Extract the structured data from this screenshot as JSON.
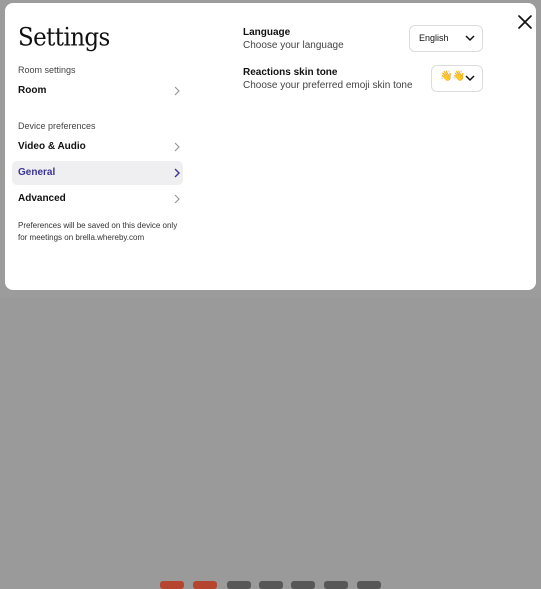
{
  "settings": {
    "title": "Settings",
    "room_section": "Room settings",
    "device_section": "Device preferences",
    "nav": [
      {
        "label": "Room",
        "active": false
      },
      {
        "label": "Video & Audio",
        "active": false
      },
      {
        "label": "General",
        "active": true
      },
      {
        "label": "Advanced",
        "active": false
      }
    ],
    "note": "Preferences will be saved on this device only for meetings on brella.whereby.com"
  },
  "general": {
    "language": {
      "title": "Language",
      "description": "Choose your language",
      "value": "English"
    },
    "skin_tone": {
      "title": "Reactions skin tone",
      "description": "Choose your preferred emoji skin tone",
      "value": "👋👋"
    }
  },
  "icons": [
    "close-icon",
    "chevron-right-icon",
    "chevron-down-icon"
  ],
  "colors": {
    "accent": "#3b3496",
    "active_bg": "#efeff1",
    "backdrop": "#9c9c9c"
  }
}
